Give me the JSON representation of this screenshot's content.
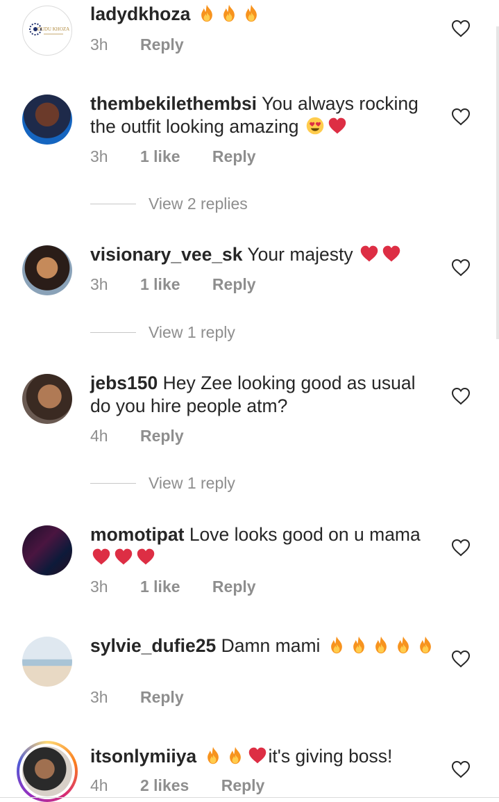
{
  "comments": [
    {
      "user": "ladydkhoza",
      "text": "",
      "time": "3h",
      "likes": "",
      "reply": "Reply",
      "emoji": [
        "fire",
        "fire",
        "fire"
      ],
      "logo_text": "DUDU KHOZA"
    },
    {
      "user": "thembekilethembsi",
      "text": "You always rocking the outfit looking amazing",
      "time": "3h",
      "likes": "1 like",
      "reply": "Reply",
      "view_replies": "View 2 replies"
    },
    {
      "user": "visionary_vee_sk",
      "text": "Your majesty",
      "time": "3h",
      "likes": "1 like",
      "reply": "Reply",
      "view_replies": "View 1 reply"
    },
    {
      "user": "jebs150",
      "text": "Hey Zee looking good as usual do you hire people atm?",
      "time": "4h",
      "likes": "",
      "reply": "Reply",
      "view_replies": "View 1 reply"
    },
    {
      "user": "momotipat",
      "text": "Love looks good on u mama",
      "time": "3h",
      "likes": "1 like",
      "reply": "Reply"
    },
    {
      "user": "sylvie_dufie25",
      "text": "Damn mami",
      "time": "3h",
      "likes": "",
      "reply": "Reply"
    },
    {
      "user": "itsonlymiiya",
      "text": "it's giving boss!",
      "time": "4h",
      "likes": "2 likes",
      "reply": "Reply"
    }
  ],
  "colors": {
    "text": "#262626",
    "meta": "#8e8e8e",
    "heart": "#e0245e",
    "fire": "#f7931e"
  }
}
